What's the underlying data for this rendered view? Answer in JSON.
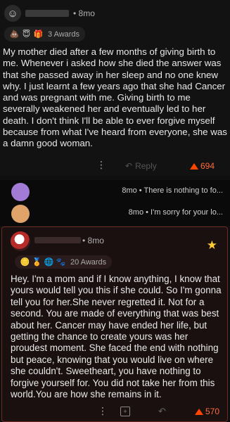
{
  "comment1": {
    "time": "8mo",
    "awards_label": "3 Awards",
    "body": "My mother died after a few months of giving birth to me. Whenever i asked how she died the answer was that she passed away in her sleep and no one knew why. I just learnt a few years ago that she had Cancer and was pregnant with me. Giving birth to me severally weakened her and eventually led to her death. I don't think I'll be able to ever forgive myself because from what I've heard from everyone, she was a damn good woman.",
    "reply_label": "Reply",
    "score": "694"
  },
  "collapsed_replies": [
    {
      "text": "8mo • There is nothing to fo..."
    },
    {
      "text": "8mo • I'm sorry for your lo..."
    }
  ],
  "comment2": {
    "time": "8mo",
    "awards_label": "20 Awards",
    "body": "Hey. I'm a mom and if I know anything, I know that yours would tell you this if she could. So I'm gonna tell you for her.She never regretted it. Not for a second. You are made of everything that was best about her. Cancer may have ended her life, but getting the chance to create yours was her proudest moment. She faced the end with nothing but peace, knowing that you would live on where she couldn't. Sweetheart, you have nothing to forgive yourself for.  You did not take her from this world.You are how she remains in it.",
    "score": "570"
  },
  "colors": {
    "upvote": "#ff4500",
    "highlight_border": "#6e2a24",
    "reply_avatar_1": "#a27bd6",
    "reply_avatar_2": "#e0a36a"
  }
}
